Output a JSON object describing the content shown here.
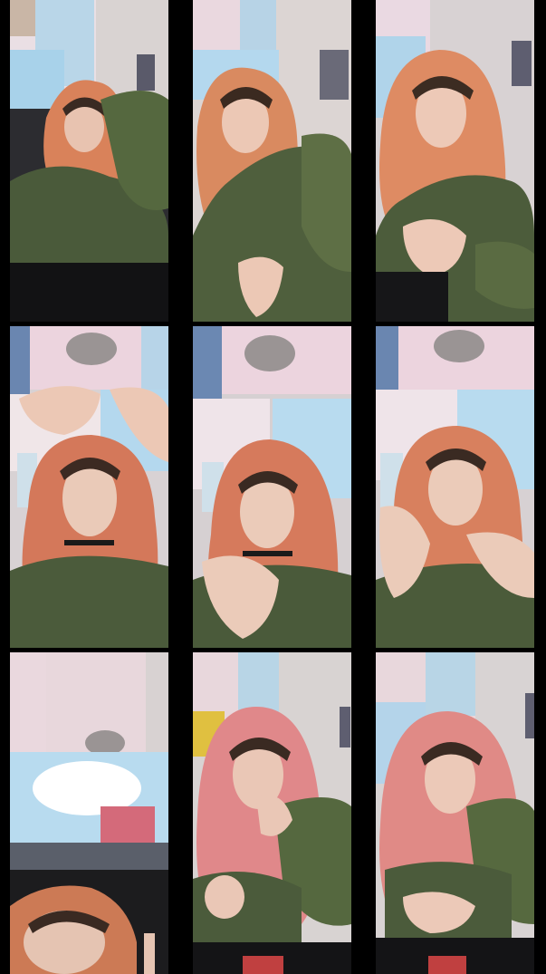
{
  "grid": {
    "rows": 3,
    "columns": 3,
    "background_color": "#000000"
  },
  "frames": [
    {
      "id": "frame-1",
      "scene": "wall-poster-room",
      "hair_color": "#d9825a",
      "outfit": "camo"
    },
    {
      "id": "frame-2",
      "scene": "wall-poster-room",
      "hair_color": "#d98a60",
      "outfit": "camo"
    },
    {
      "id": "frame-3",
      "scene": "wall-poster-room",
      "hair_color": "#de8b63",
      "outfit": "camo"
    },
    {
      "id": "frame-4",
      "scene": "anime-poster-wall",
      "hair_color": "#d4785a",
      "outfit": "camo"
    },
    {
      "id": "frame-5",
      "scene": "anime-poster-wall",
      "hair_color": "#d67a5c",
      "outfit": "camo"
    },
    {
      "id": "frame-6",
      "scene": "anime-poster-wall",
      "hair_color": "#d8805e",
      "outfit": "camo"
    },
    {
      "id": "frame-7",
      "scene": "cinnamoroll-poster-wall",
      "hair_color": "#cc7a55",
      "outfit": "camo"
    },
    {
      "id": "frame-8",
      "scene": "wall-poster-room",
      "hair_color": "#e0888a",
      "outfit": "camo"
    },
    {
      "id": "frame-9",
      "scene": "wall-poster-room",
      "hair_color": "#e08a86",
      "outfit": "camo"
    }
  ]
}
